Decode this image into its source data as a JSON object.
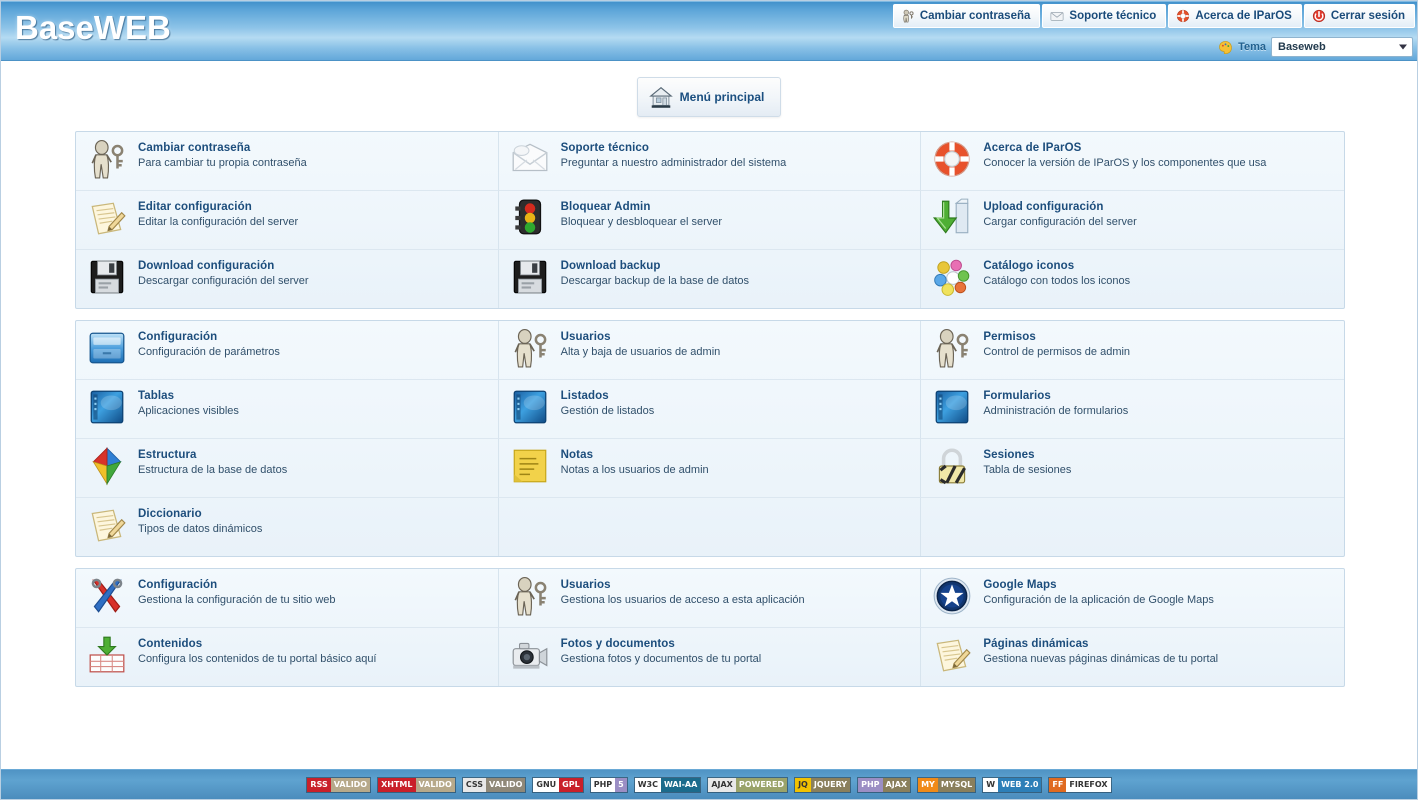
{
  "app": {
    "brand": "BaseWEB",
    "theme_accent": "#1c4d7c",
    "header_gradient_top": "#3f8fc9",
    "header_gradient_mid": "#b5dbf2"
  },
  "header": {
    "buttons": [
      {
        "label": "Cambiar contraseña",
        "icon": "user-key-icon"
      },
      {
        "label": "Soporte técnico",
        "icon": "envelope-icon"
      },
      {
        "label": "Acerca de IParOS",
        "icon": "lifering-icon"
      },
      {
        "label": "Cerrar sesión",
        "icon": "logout-icon"
      }
    ],
    "theme": {
      "label": "Tema",
      "selected": "Baseweb",
      "options": [
        "Baseweb"
      ]
    }
  },
  "toolbar": {
    "home_label": "Menú principal",
    "home_icon": "home-icon"
  },
  "panels": [
    {
      "id": "panel-sistema",
      "cells": [
        {
          "title": "Cambiar contraseña",
          "desc": "Para cambiar tu propia contraseña",
          "icon": "user-key-icon"
        },
        {
          "title": "Soporte técnico",
          "desc": "Preguntar a nuestro administrador del sistema",
          "icon": "envelope-icon"
        },
        {
          "title": "Acerca de IParOS",
          "desc": "Conocer la versión de IParOS y los componentes que usa",
          "icon": "lifering-icon"
        },
        {
          "title": "Editar configuración",
          "desc": "Editar la configuración del server",
          "icon": "notepad-pencil-icon"
        },
        {
          "title": "Bloquear Admin",
          "desc": "Bloquear y desbloquear el server",
          "icon": "traffic-light-icon"
        },
        {
          "title": "Upload configuración",
          "desc": "Cargar configuración del server",
          "icon": "download-arrow-icon"
        },
        {
          "title": "Download configuración",
          "desc": "Descargar configuración del server",
          "icon": "floppy-icon"
        },
        {
          "title": "Download backup",
          "desc": "Descargar backup de la base de datos",
          "icon": "floppy-icon"
        },
        {
          "title": "Catálogo iconos",
          "desc": "Catálogo con todos los iconos",
          "icon": "color-balls-icon"
        }
      ]
    },
    {
      "id": "panel-admin",
      "cells": [
        {
          "title": "Configuración",
          "desc": "Configuración de parámetros",
          "icon": "drawer-icon"
        },
        {
          "title": "Usuarios",
          "desc": "Alta y baja de usuarios de admin",
          "icon": "user-key-icon"
        },
        {
          "title": "Permisos",
          "desc": "Control de permisos de admin",
          "icon": "user-key-icon"
        },
        {
          "title": "Tablas",
          "desc": "Aplicaciones visibles",
          "icon": "blue-window-icon"
        },
        {
          "title": "Listados",
          "desc": "Gestión de listados",
          "icon": "blue-window-icon"
        },
        {
          "title": "Formularios",
          "desc": "Administración de formularios",
          "icon": "blue-window-icon"
        },
        {
          "title": "Estructura",
          "desc": "Estructura de la base de datos",
          "icon": "color-diamond-icon"
        },
        {
          "title": "Notas",
          "desc": "Notas a los usuarios de admin",
          "icon": "sticky-note-icon"
        },
        {
          "title": "Sesiones",
          "desc": "Tabla de sesiones",
          "icon": "padlock-icon"
        },
        {
          "title": "Diccionario",
          "desc": "Tipos de datos dinámicos",
          "icon": "notepad-pencil-icon"
        },
        {
          "title": "",
          "desc": "",
          "icon": ""
        },
        {
          "title": "",
          "desc": "",
          "icon": ""
        }
      ]
    },
    {
      "id": "panel-portal",
      "cells": [
        {
          "title": "Configuración",
          "desc": "Gestiona la configuración de tu sitio web",
          "icon": "tools-icon"
        },
        {
          "title": "Usuarios",
          "desc": "Gestiona los usuarios de acceso a esta aplicación",
          "icon": "user-key-icon"
        },
        {
          "title": "Google Maps",
          "desc": "Configuración de la aplicación de Google Maps",
          "icon": "globe-badge-icon"
        },
        {
          "title": "Contenidos",
          "desc": "Configura los contenidos de tu portal básico aquí",
          "icon": "import-table-icon"
        },
        {
          "title": "Fotos y documentos",
          "desc": "Gestiona fotos y documentos de tu portal",
          "icon": "camera-icon"
        },
        {
          "title": "Páginas dinámicas",
          "desc": "Gestiona nuevas páginas dinámicas de tu portal",
          "icon": "notepad-pencil-icon"
        }
      ]
    }
  ],
  "footer": {
    "badges": [
      {
        "left": "RSS",
        "right": "VALIDO",
        "left_bg": "#c9202a",
        "right_bg": "#b7a98a",
        "right_fg": "#ffffff"
      },
      {
        "left": "XHTML",
        "right": "VALIDO",
        "left_bg": "#c9202a",
        "right_bg": "#b7a98a",
        "right_fg": "#ffffff"
      },
      {
        "left": "CSS",
        "right": "VALIDO",
        "left_bg": "#e8e8e8",
        "right_bg": "#8f8878",
        "right_fg": "#ffffff"
      },
      {
        "left": "GNU",
        "right": "GPL",
        "left_bg": "#ffffff",
        "right_bg": "#c9202a",
        "right_fg": "#ffffff"
      },
      {
        "left": "PHP",
        "right": "5",
        "left_bg": "#ffffff",
        "right_bg": "#9b8ec4",
        "right_fg": "#ffffff"
      },
      {
        "left": "W3C",
        "right": "WAI-AA",
        "left_bg": "#ffffff",
        "right_bg": "#1c6b8c",
        "right_fg": "#ffffff"
      },
      {
        "left": "AJAX",
        "right": "POWERED",
        "left_bg": "#e8e8e8",
        "right_bg": "#9aa36a",
        "right_fg": "#ffffff"
      },
      {
        "left": "JQ",
        "right": "JQUERY",
        "left_bg": "#f2c200",
        "right_bg": "#8a7f5c",
        "right_fg": "#ffffff"
      },
      {
        "left": "PHP",
        "right": "AJAX",
        "left_bg": "#9b8ec4",
        "right_bg": "#8a7f5c",
        "right_fg": "#ffffff"
      },
      {
        "left": "MY",
        "right": "MYSQL",
        "left_bg": "#f08a17",
        "right_bg": "#8a7f5c",
        "right_fg": "#ffffff"
      },
      {
        "left": "W",
        "right": "WEB 2.0",
        "left_bg": "#ffffff",
        "right_bg": "#2d7fb8",
        "right_fg": "#ffffff"
      },
      {
        "left": "FF",
        "right": "FIREFOX",
        "left_bg": "#e06a20",
        "right_bg": "#ffffff",
        "right_fg": "#333333"
      }
    ]
  }
}
